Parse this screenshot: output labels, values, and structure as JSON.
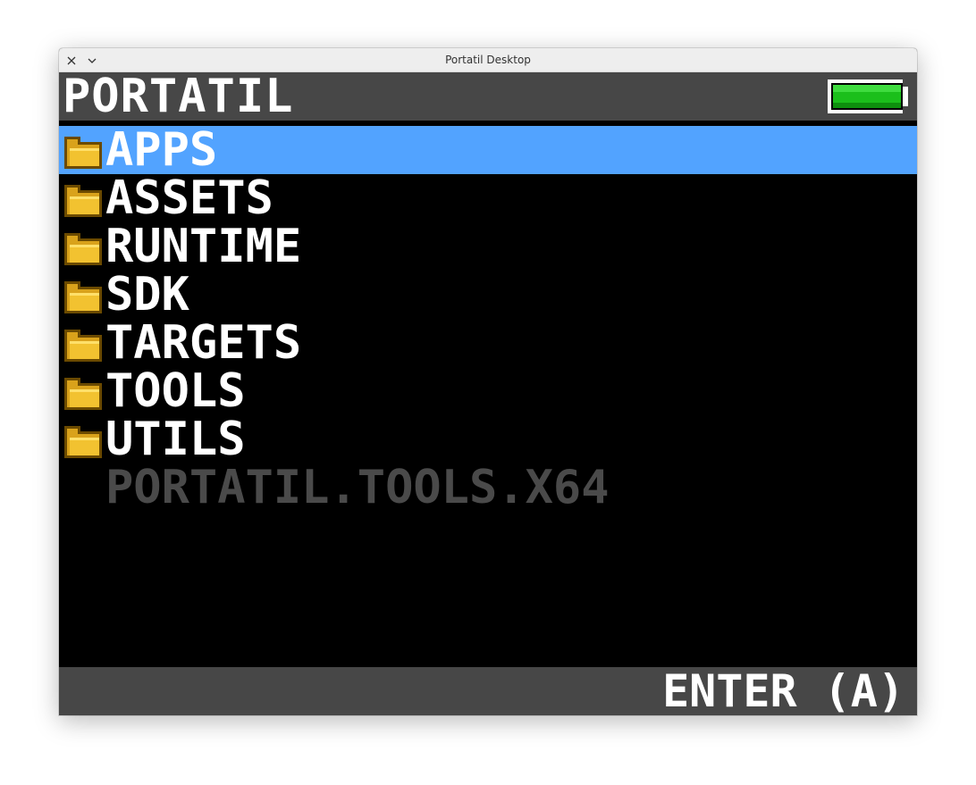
{
  "window": {
    "title": "Portatil Desktop"
  },
  "header": {
    "title": "PORTATIL",
    "battery_level": 1.0,
    "battery_color": "#1bbf1b"
  },
  "list": {
    "items": [
      {
        "label": "APPS",
        "type": "folder",
        "selected": true
      },
      {
        "label": "ASSETS",
        "type": "folder",
        "selected": false
      },
      {
        "label": "RUNTIME",
        "type": "folder",
        "selected": false
      },
      {
        "label": "SDK",
        "type": "folder",
        "selected": false
      },
      {
        "label": "TARGETS",
        "type": "folder",
        "selected": false
      },
      {
        "label": "TOOLS",
        "type": "folder",
        "selected": false
      },
      {
        "label": "UTILS",
        "type": "folder",
        "selected": false
      },
      {
        "label": "PORTATIL.TOOLS.X64",
        "type": "file",
        "selected": false
      }
    ]
  },
  "footer": {
    "hint": "ENTER (A)"
  },
  "colors": {
    "selection": "#52a3ff",
    "bar": "#474747",
    "folder": "#d9a21b",
    "disabled_text": "#4a4a4a"
  }
}
